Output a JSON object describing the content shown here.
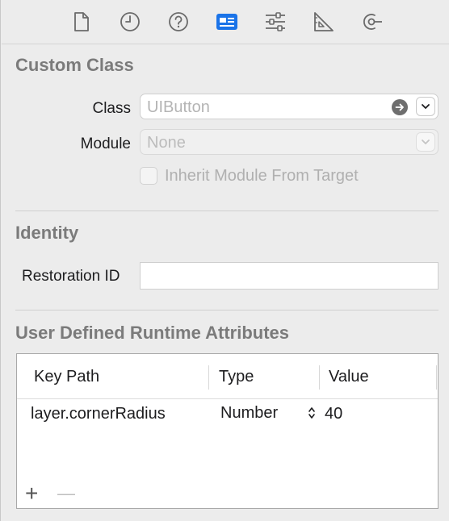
{
  "toolbar": {
    "tabs": [
      {
        "icon": "file-icon",
        "selected": false
      },
      {
        "icon": "history-icon",
        "selected": false
      },
      {
        "icon": "help-icon",
        "selected": false
      },
      {
        "icon": "identity-inspector-icon",
        "selected": true
      },
      {
        "icon": "attributes-inspector-icon",
        "selected": false
      },
      {
        "icon": "size-inspector-icon",
        "selected": false
      },
      {
        "icon": "connections-inspector-icon",
        "selected": false
      }
    ],
    "accent_color": "#1a73e8"
  },
  "custom_class": {
    "title": "Custom Class",
    "class_label": "Class",
    "class_placeholder": "UIButton",
    "module_label": "Module",
    "module_placeholder": "None",
    "inherit_label": "Inherit Module From Target",
    "inherit_checked": false
  },
  "identity": {
    "title": "Identity",
    "restoration_label": "Restoration ID",
    "restoration_value": ""
  },
  "runtime_attributes": {
    "title": "User Defined Runtime Attributes",
    "columns": [
      "Key Path",
      "Type",
      "Value"
    ],
    "rows": [
      {
        "key_path": "layer.cornerRadius",
        "type": "Number",
        "value": "40"
      }
    ],
    "add_label": "+",
    "remove_label": "—"
  }
}
